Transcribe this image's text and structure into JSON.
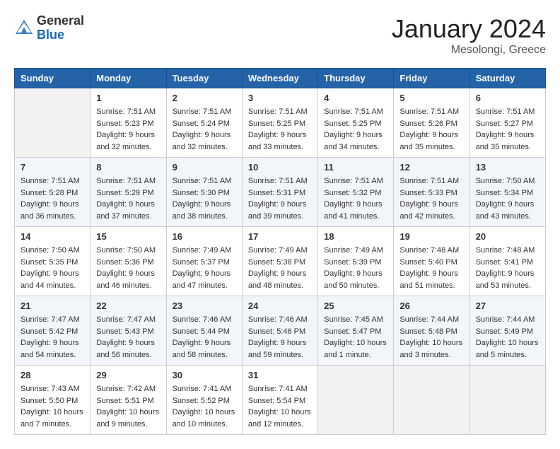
{
  "header": {
    "logo_general": "General",
    "logo_blue": "Blue",
    "month_title": "January 2024",
    "location": "Mesolongi, Greece"
  },
  "days_of_week": [
    "Sunday",
    "Monday",
    "Tuesday",
    "Wednesday",
    "Thursday",
    "Friday",
    "Saturday"
  ],
  "weeks": [
    [
      {
        "day": "",
        "info": ""
      },
      {
        "day": "1",
        "info": "Sunrise: 7:51 AM\nSunset: 5:23 PM\nDaylight: 9 hours\nand 32 minutes."
      },
      {
        "day": "2",
        "info": "Sunrise: 7:51 AM\nSunset: 5:24 PM\nDaylight: 9 hours\nand 32 minutes."
      },
      {
        "day": "3",
        "info": "Sunrise: 7:51 AM\nSunset: 5:25 PM\nDaylight: 9 hours\nand 33 minutes."
      },
      {
        "day": "4",
        "info": "Sunrise: 7:51 AM\nSunset: 5:25 PM\nDaylight: 9 hours\nand 34 minutes."
      },
      {
        "day": "5",
        "info": "Sunrise: 7:51 AM\nSunset: 5:26 PM\nDaylight: 9 hours\nand 35 minutes."
      },
      {
        "day": "6",
        "info": "Sunrise: 7:51 AM\nSunset: 5:27 PM\nDaylight: 9 hours\nand 35 minutes."
      }
    ],
    [
      {
        "day": "7",
        "info": "Sunrise: 7:51 AM\nSunset: 5:28 PM\nDaylight: 9 hours\nand 36 minutes."
      },
      {
        "day": "8",
        "info": "Sunrise: 7:51 AM\nSunset: 5:29 PM\nDaylight: 9 hours\nand 37 minutes."
      },
      {
        "day": "9",
        "info": "Sunrise: 7:51 AM\nSunset: 5:30 PM\nDaylight: 9 hours\nand 38 minutes."
      },
      {
        "day": "10",
        "info": "Sunrise: 7:51 AM\nSunset: 5:31 PM\nDaylight: 9 hours\nand 39 minutes."
      },
      {
        "day": "11",
        "info": "Sunrise: 7:51 AM\nSunset: 5:32 PM\nDaylight: 9 hours\nand 41 minutes."
      },
      {
        "day": "12",
        "info": "Sunrise: 7:51 AM\nSunset: 5:33 PM\nDaylight: 9 hours\nand 42 minutes."
      },
      {
        "day": "13",
        "info": "Sunrise: 7:50 AM\nSunset: 5:34 PM\nDaylight: 9 hours\nand 43 minutes."
      }
    ],
    [
      {
        "day": "14",
        "info": "Sunrise: 7:50 AM\nSunset: 5:35 PM\nDaylight: 9 hours\nand 44 minutes."
      },
      {
        "day": "15",
        "info": "Sunrise: 7:50 AM\nSunset: 5:36 PM\nDaylight: 9 hours\nand 46 minutes."
      },
      {
        "day": "16",
        "info": "Sunrise: 7:49 AM\nSunset: 5:37 PM\nDaylight: 9 hours\nand 47 minutes."
      },
      {
        "day": "17",
        "info": "Sunrise: 7:49 AM\nSunset: 5:38 PM\nDaylight: 9 hours\nand 48 minutes."
      },
      {
        "day": "18",
        "info": "Sunrise: 7:49 AM\nSunset: 5:39 PM\nDaylight: 9 hours\nand 50 minutes."
      },
      {
        "day": "19",
        "info": "Sunrise: 7:48 AM\nSunset: 5:40 PM\nDaylight: 9 hours\nand 51 minutes."
      },
      {
        "day": "20",
        "info": "Sunrise: 7:48 AM\nSunset: 5:41 PM\nDaylight: 9 hours\nand 53 minutes."
      }
    ],
    [
      {
        "day": "21",
        "info": "Sunrise: 7:47 AM\nSunset: 5:42 PM\nDaylight: 9 hours\nand 54 minutes."
      },
      {
        "day": "22",
        "info": "Sunrise: 7:47 AM\nSunset: 5:43 PM\nDaylight: 9 hours\nand 56 minutes."
      },
      {
        "day": "23",
        "info": "Sunrise: 7:46 AM\nSunset: 5:44 PM\nDaylight: 9 hours\nand 58 minutes."
      },
      {
        "day": "24",
        "info": "Sunrise: 7:46 AM\nSunset: 5:46 PM\nDaylight: 9 hours\nand 59 minutes."
      },
      {
        "day": "25",
        "info": "Sunrise: 7:45 AM\nSunset: 5:47 PM\nDaylight: 10 hours\nand 1 minute."
      },
      {
        "day": "26",
        "info": "Sunrise: 7:44 AM\nSunset: 5:48 PM\nDaylight: 10 hours\nand 3 minutes."
      },
      {
        "day": "27",
        "info": "Sunrise: 7:44 AM\nSunset: 5:49 PM\nDaylight: 10 hours\nand 5 minutes."
      }
    ],
    [
      {
        "day": "28",
        "info": "Sunrise: 7:43 AM\nSunset: 5:50 PM\nDaylight: 10 hours\nand 7 minutes."
      },
      {
        "day": "29",
        "info": "Sunrise: 7:42 AM\nSunset: 5:51 PM\nDaylight: 10 hours\nand 9 minutes."
      },
      {
        "day": "30",
        "info": "Sunrise: 7:41 AM\nSunset: 5:52 PM\nDaylight: 10 hours\nand 10 minutes."
      },
      {
        "day": "31",
        "info": "Sunrise: 7:41 AM\nSunset: 5:54 PM\nDaylight: 10 hours\nand 12 minutes."
      },
      {
        "day": "",
        "info": ""
      },
      {
        "day": "",
        "info": ""
      },
      {
        "day": "",
        "info": ""
      }
    ]
  ]
}
